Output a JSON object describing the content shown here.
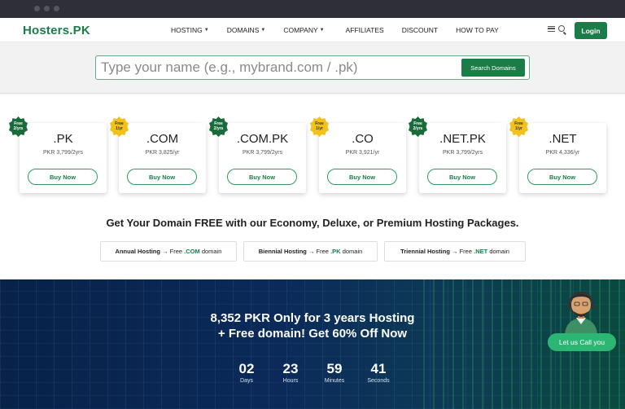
{
  "header": {
    "logo": "Hosters.PK",
    "nav": [
      {
        "label": "HOSTING",
        "dropdown": true
      },
      {
        "label": "DOMAINS",
        "dropdown": true
      },
      {
        "label": "COMPANY",
        "dropdown": true
      },
      {
        "label": "AFFILIATES",
        "dropdown": false
      },
      {
        "label": "DISCOUNT",
        "dropdown": false
      },
      {
        "label": "HOW TO PAY",
        "dropdown": false
      }
    ],
    "login_label": "Login"
  },
  "search": {
    "placeholder": "Type your name (e.g., mybrand.com / .pk)",
    "value": "",
    "button_label": "Search Domains"
  },
  "domains": [
    {
      "ext": ".PK",
      "price": "PKR 3,799/2yrs",
      "badge": "Free\n2/yrs",
      "badge_color": "green",
      "buy_label": "Buy Now"
    },
    {
      "ext": ".COM",
      "price": "PKR 3,825/yr",
      "badge": "Free\n1/yr",
      "badge_color": "yellow",
      "buy_label": "Buy Now"
    },
    {
      "ext": ".COM.PK",
      "price": "PKR 3,799/2yrs",
      "badge": "Free\n2/yrs",
      "badge_color": "green",
      "buy_label": "Buy Now"
    },
    {
      "ext": ".CO",
      "price": "PKR 3,921/yr",
      "badge": "Free\n1/yr",
      "badge_color": "yellow",
      "buy_label": "Buy Now"
    },
    {
      "ext": ".NET.PK",
      "price": "PKR 3,799/2yrs",
      "badge": "Free\n2/yrs",
      "badge_color": "green",
      "buy_label": "Buy Now"
    },
    {
      "ext": ".NET",
      "price": "PKR 4,336/yr",
      "badge": "Free\n1/yr",
      "badge_color": "yellow",
      "buy_label": "Buy Now"
    }
  ],
  "promo": {
    "headline": "Get Your Domain FREE with our Economy, Deluxe, or Premium Hosting Packages.",
    "packages": [
      {
        "plan": "Annual Hosting",
        "arrow": "→ Free",
        "ext": ".COM",
        "suffix": "domain"
      },
      {
        "plan": "Biennial Hosting",
        "arrow": "→ Free",
        "ext": ".PK",
        "suffix": "domain"
      },
      {
        "plan": "Triennial Hosting",
        "arrow": "→ Free",
        "ext": ".NET",
        "suffix": "domain"
      }
    ]
  },
  "hero": {
    "line1": "8,352 PKR Only for 3 years Hosting",
    "line2": "+ Free domain! Get 60% Off Now",
    "countdown": [
      {
        "value": "02",
        "label": "Days"
      },
      {
        "value": "23",
        "label": "Hours"
      },
      {
        "value": "59",
        "label": "Minutes"
      },
      {
        "value": "41",
        "label": "Seconds"
      }
    ],
    "call_label": "Let us Call you"
  },
  "colors": {
    "brand_green": "#1a7d47",
    "badge_green": "#1a6b3c",
    "badge_yellow": "#f2c21a",
    "hero_blue": "#0b2a5a",
    "call_green": "#2bb673"
  },
  "icons": [
    "menu-icon",
    "search-icon",
    "caret-down-icon",
    "badge-seal-icon",
    "support-agent-icon"
  ]
}
